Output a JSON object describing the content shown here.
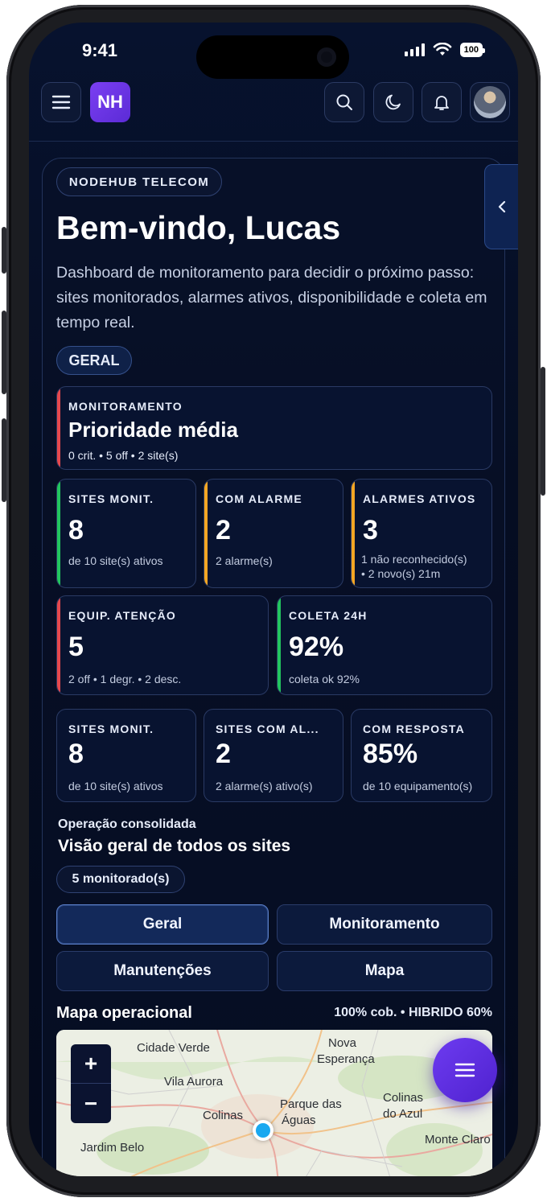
{
  "status_bar": {
    "time": "9:41",
    "battery": "100"
  },
  "topbar": {
    "logo_text": "NH"
  },
  "hero": {
    "company": "NODEHUB TELECOM",
    "welcome": "Bem-vindo, Lucas",
    "description": "Dashboard de monitoramento para decidir o próximo passo: sites monitorados, alarmes ativos, disponibilidade e coleta em tempo real.",
    "scope_chip": "GERAL"
  },
  "priority_card": {
    "label": "MONITORAMENTO",
    "value": "Prioridade média",
    "sub": "0 crit. • 5 off • 2 site(s)",
    "accent": "#e5484d"
  },
  "stats_row1": [
    {
      "label": "SITES MONIT.",
      "value": "8",
      "sub": "de 10 site(s) ativos",
      "accent": "#22c55e"
    },
    {
      "label": "COM ALARME",
      "value": "2",
      "sub": "2 alarme(s)",
      "accent": "#f5a623"
    },
    {
      "label": "ALARMES ATIVOS",
      "value": "3",
      "sub1": "1 não reconhecido(s)",
      "sub2": "• 2 novo(s) 21m",
      "accent": "#f5a623"
    }
  ],
  "stats_row2": [
    {
      "label": "EQUIP. ATENÇÃO",
      "value": "5",
      "sub": "2 off • 1 degr. • 2 desc.",
      "accent": "#e5484d"
    },
    {
      "label": "COLETA 24H",
      "value": "92%",
      "sub": "coleta ok 92%",
      "accent": "#22c55e"
    }
  ],
  "stats_row3": [
    {
      "label": "SITES MONIT.",
      "value": "8",
      "sub": "de 10 site(s) ativos"
    },
    {
      "label": "SITES COM AL...",
      "value": "2",
      "sub": "2 alarme(s) ativo(s)"
    },
    {
      "label": "COM RESPOSTA",
      "value": "85%",
      "sub": "de 10 equipamento(s)"
    }
  ],
  "overview": {
    "kicker": "Operação consolidada",
    "title": "Visão geral de todos os sites",
    "chip": "5 monitorado(s)"
  },
  "tabs": [
    "Geral",
    "Monitoramento",
    "Manutenções",
    "Mapa"
  ],
  "active_tab": "Geral",
  "map": {
    "title": "Mapa operacional",
    "meta": "100% cob. • HIBRIDO 60%",
    "zoom_in": "+",
    "zoom_out": "−",
    "places": [
      "Cidade Verde",
      "Nova",
      "Esperança",
      "Vila Aurora",
      "Parque das",
      "Águas",
      "Colinas",
      "Colinas",
      "do Azul",
      "Jardim Belo",
      "Monte Claro"
    ]
  }
}
